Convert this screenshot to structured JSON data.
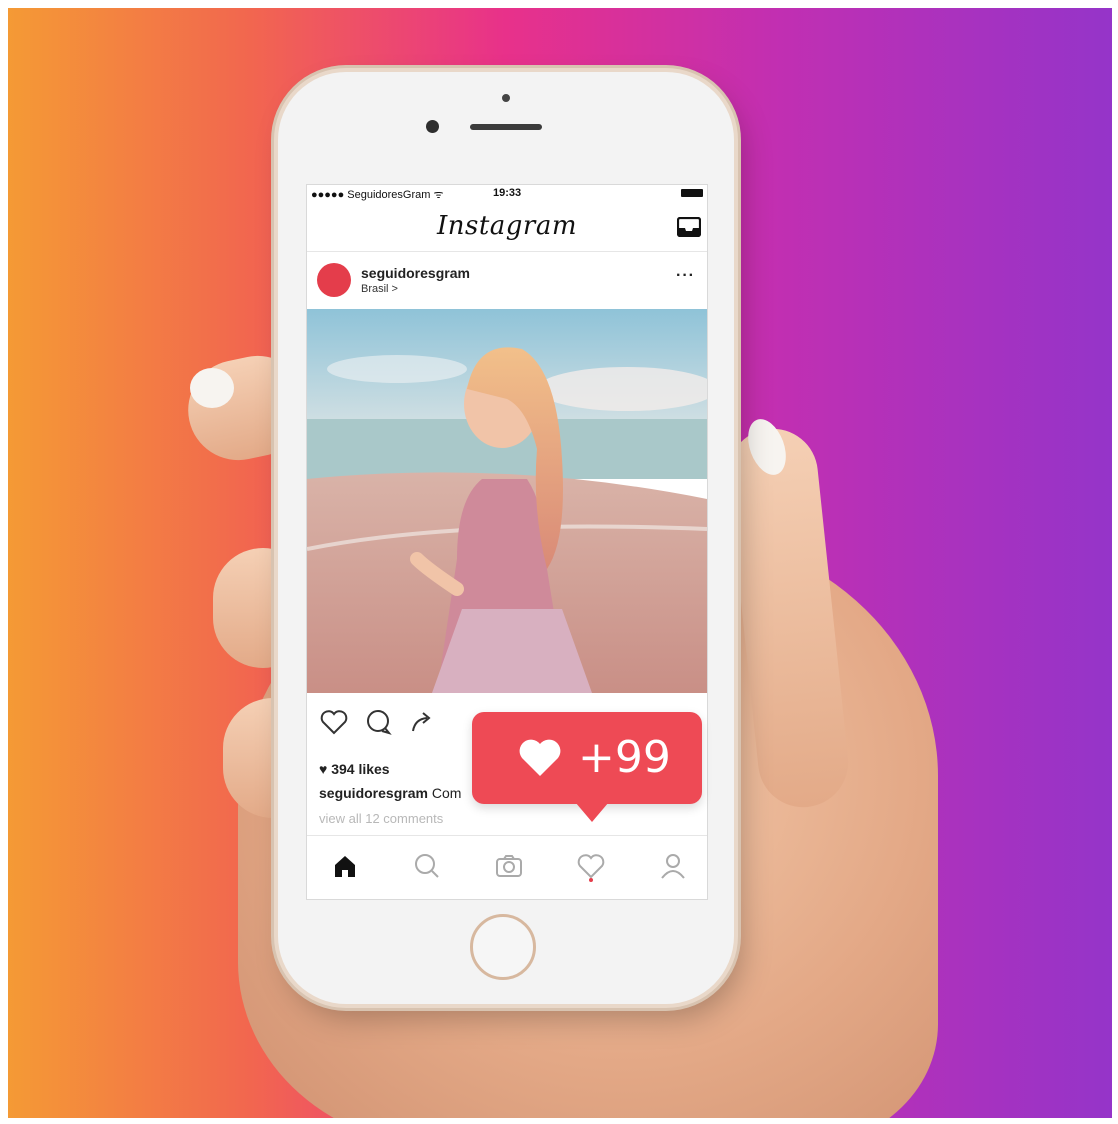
{
  "status_bar": {
    "carrier": "●●●●● SeguidoresGram ᯤ",
    "time": "19:33"
  },
  "header": {
    "logo": "Instagram"
  },
  "post": {
    "username": "seguidoresgram",
    "location": "Brasil >",
    "more": "···",
    "likes": "394 likes",
    "caption_user": "seguidoresgram",
    "caption_text": "Com",
    "view_all": "view all 12 comments"
  },
  "notification": {
    "count": "+99"
  },
  "colors": {
    "accent": "#ee4a55",
    "avatar": "#e43d4b",
    "gradient_start": "#f49a35",
    "gradient_end": "#9534c9"
  },
  "icons": {
    "actions": [
      "heart-icon",
      "comment-icon",
      "share-icon"
    ],
    "tabs": [
      "home-icon",
      "search-icon",
      "camera-icon",
      "activity-heart-icon",
      "profile-icon"
    ]
  }
}
